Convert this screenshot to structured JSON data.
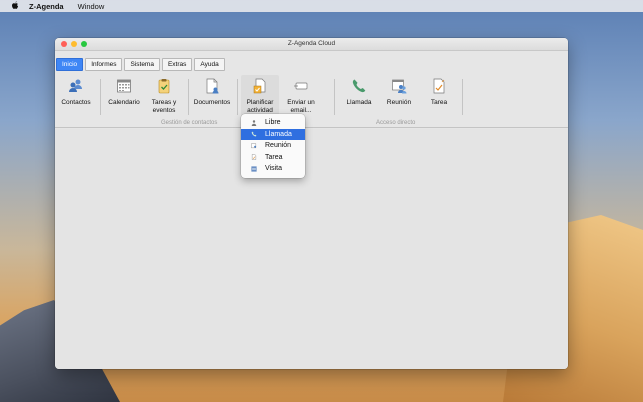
{
  "menubar": {
    "app_name": "Z-Agenda",
    "items": [
      "Window"
    ]
  },
  "window": {
    "title": "Z-Agenda Cloud",
    "tabs": [
      "Inicio",
      "Informes",
      "Sistema",
      "Extras",
      "Ayuda"
    ],
    "active_tab": "Inicio"
  },
  "ribbon": {
    "tools": [
      {
        "label1": "Contactos",
        "label2": ""
      },
      {
        "label1": "Calendario",
        "label2": ""
      },
      {
        "label1": "Tareas y",
        "label2": "eventos"
      },
      {
        "label1": "Documentos",
        "label2": ""
      },
      {
        "label1": "Planificar",
        "label2": "actividad"
      },
      {
        "label1": "Enviar un",
        "label2": "email..."
      },
      {
        "label1": "Llamada",
        "label2": ""
      },
      {
        "label1": "Reunión",
        "label2": ""
      },
      {
        "label1": "Tarea",
        "label2": ""
      }
    ],
    "groups": [
      "Gestión de contactos",
      "Acceso directo"
    ]
  },
  "dropdown": {
    "items": [
      "Libre",
      "Llamada",
      "Reunión",
      "Tarea",
      "Visita"
    ],
    "highlighted": "Llamada"
  },
  "colors": {
    "accent": "#3f86f5",
    "highlight": "#2f6fe0",
    "call_green": "#4a9a6c"
  }
}
